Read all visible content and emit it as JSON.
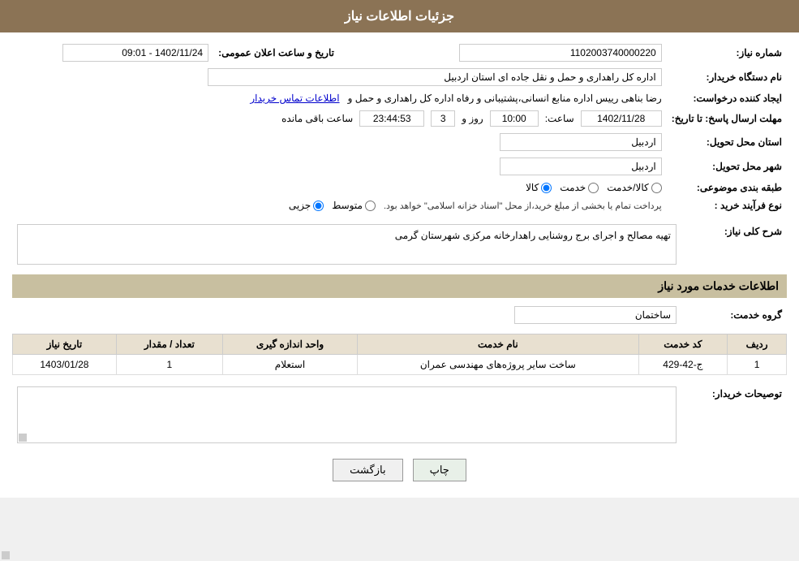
{
  "header": {
    "title": "جزئیات اطلاعات نیاز"
  },
  "fields": {
    "request_number_label": "شماره نیاز:",
    "request_number_value": "1102003740000220",
    "buyer_label": "نام دستگاه خریدار:",
    "buyer_value": "اداره کل راهداری و حمل و نقل جاده ای استان اردبیل",
    "creator_label": "ایجاد کننده درخواست:",
    "creator_value": "رضا بناهی رییس اداره منابع انسانی،پشتیبانی و رفاه اداره کل راهداری و حمل و",
    "contact_link": "اطلاعات تماس خریدار",
    "deadline_label": "مهلت ارسال پاسخ: تا تاریخ:",
    "deadline_date": "1402/11/28",
    "deadline_time_label": "ساعت:",
    "deadline_time": "10:00",
    "days_label": "روز و",
    "days_value": "3",
    "remaining_label": "ساعت باقی مانده",
    "remaining_time": "23:44:53",
    "announce_label": "تاریخ و ساعت اعلان عمومی:",
    "announce_value": "1402/11/24 - 09:01",
    "province_label": "استان محل تحویل:",
    "province_value": "اردبیل",
    "city_label": "شهر محل تحویل:",
    "city_value": "اردبیل",
    "category_label": "طبقه بندی موضوعی:",
    "category_options": [
      "کالا",
      "خدمت",
      "کالا/خدمت"
    ],
    "category_selected": "کالا",
    "purchase_type_label": "نوع فرآیند خرید :",
    "purchase_options": [
      "جزیی",
      "متوسط"
    ],
    "purchase_note": "پرداخت تمام یا بخشی از مبلغ خرید،از محل \"اسناد خزانه اسلامی\" خواهد بود.",
    "description_label": "شرح کلی نیاز:",
    "description_value": "تهیه مصالح و اجرای برج روشنایی راهدارخانه مرکزی شهرستان گرمی"
  },
  "services_section": {
    "title": "اطلاعات خدمات مورد نیاز",
    "group_label": "گروه خدمت:",
    "group_value": "ساختمان",
    "table": {
      "headers": [
        "ردیف",
        "کد خدمت",
        "نام خدمت",
        "واحد اندازه گیری",
        "تعداد / مقدار",
        "تاریخ نیاز"
      ],
      "rows": [
        {
          "row_num": "1",
          "code": "ج-42-429",
          "name": "ساخت سایر پروژه‌های مهندسی عمران",
          "unit": "استعلام",
          "quantity": "1",
          "date": "1403/01/28"
        }
      ]
    }
  },
  "buyer_description_label": "توصیحات خریدار:",
  "buttons": {
    "print": "چاپ",
    "back": "بازگشت"
  }
}
